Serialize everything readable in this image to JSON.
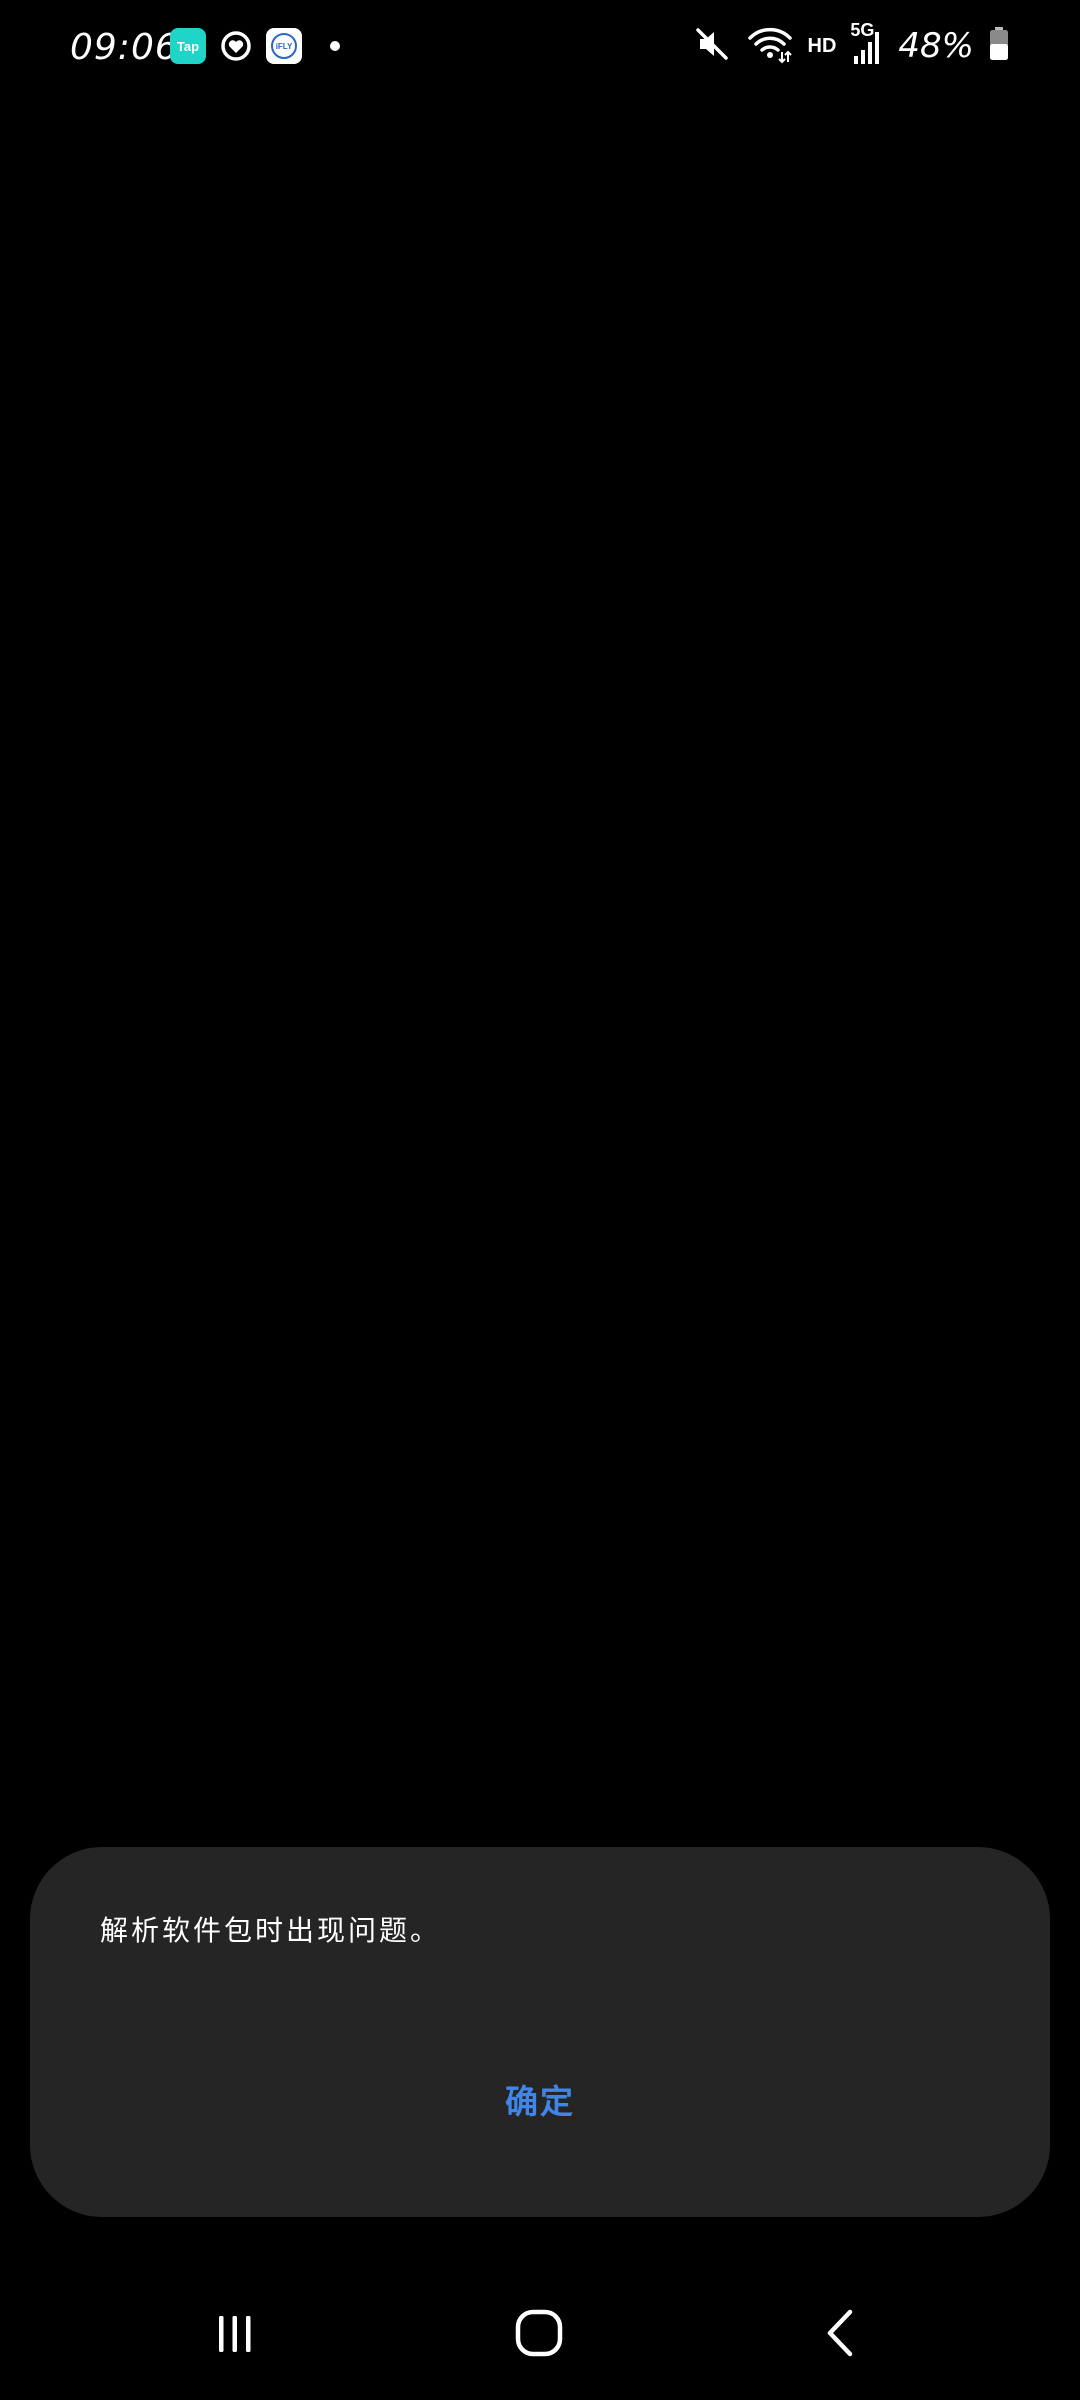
{
  "status_bar": {
    "time": "09:06",
    "notification_icons": [
      {
        "name": "taptap-icon",
        "label": "Tap"
      },
      {
        "name": "health-app-icon",
        "label": ""
      },
      {
        "name": "ifly-icon",
        "label": "iFLY"
      }
    ],
    "more_notifications": "•",
    "system_icons": {
      "mute": "mute-icon",
      "wifi": "wifi-icon",
      "hd_label": "HD",
      "network_type": "5G",
      "signal": "signal-icon",
      "battery_percent": "48%",
      "battery": "battery-icon"
    }
  },
  "dialog": {
    "message": "解析软件包时出现问题。",
    "ok_button_label": "确定",
    "accent_color": "#3f86e8",
    "background_color": "#252525"
  },
  "navigation_bar": {
    "recents": "recents-icon",
    "home": "home-icon",
    "back": "back-icon"
  }
}
